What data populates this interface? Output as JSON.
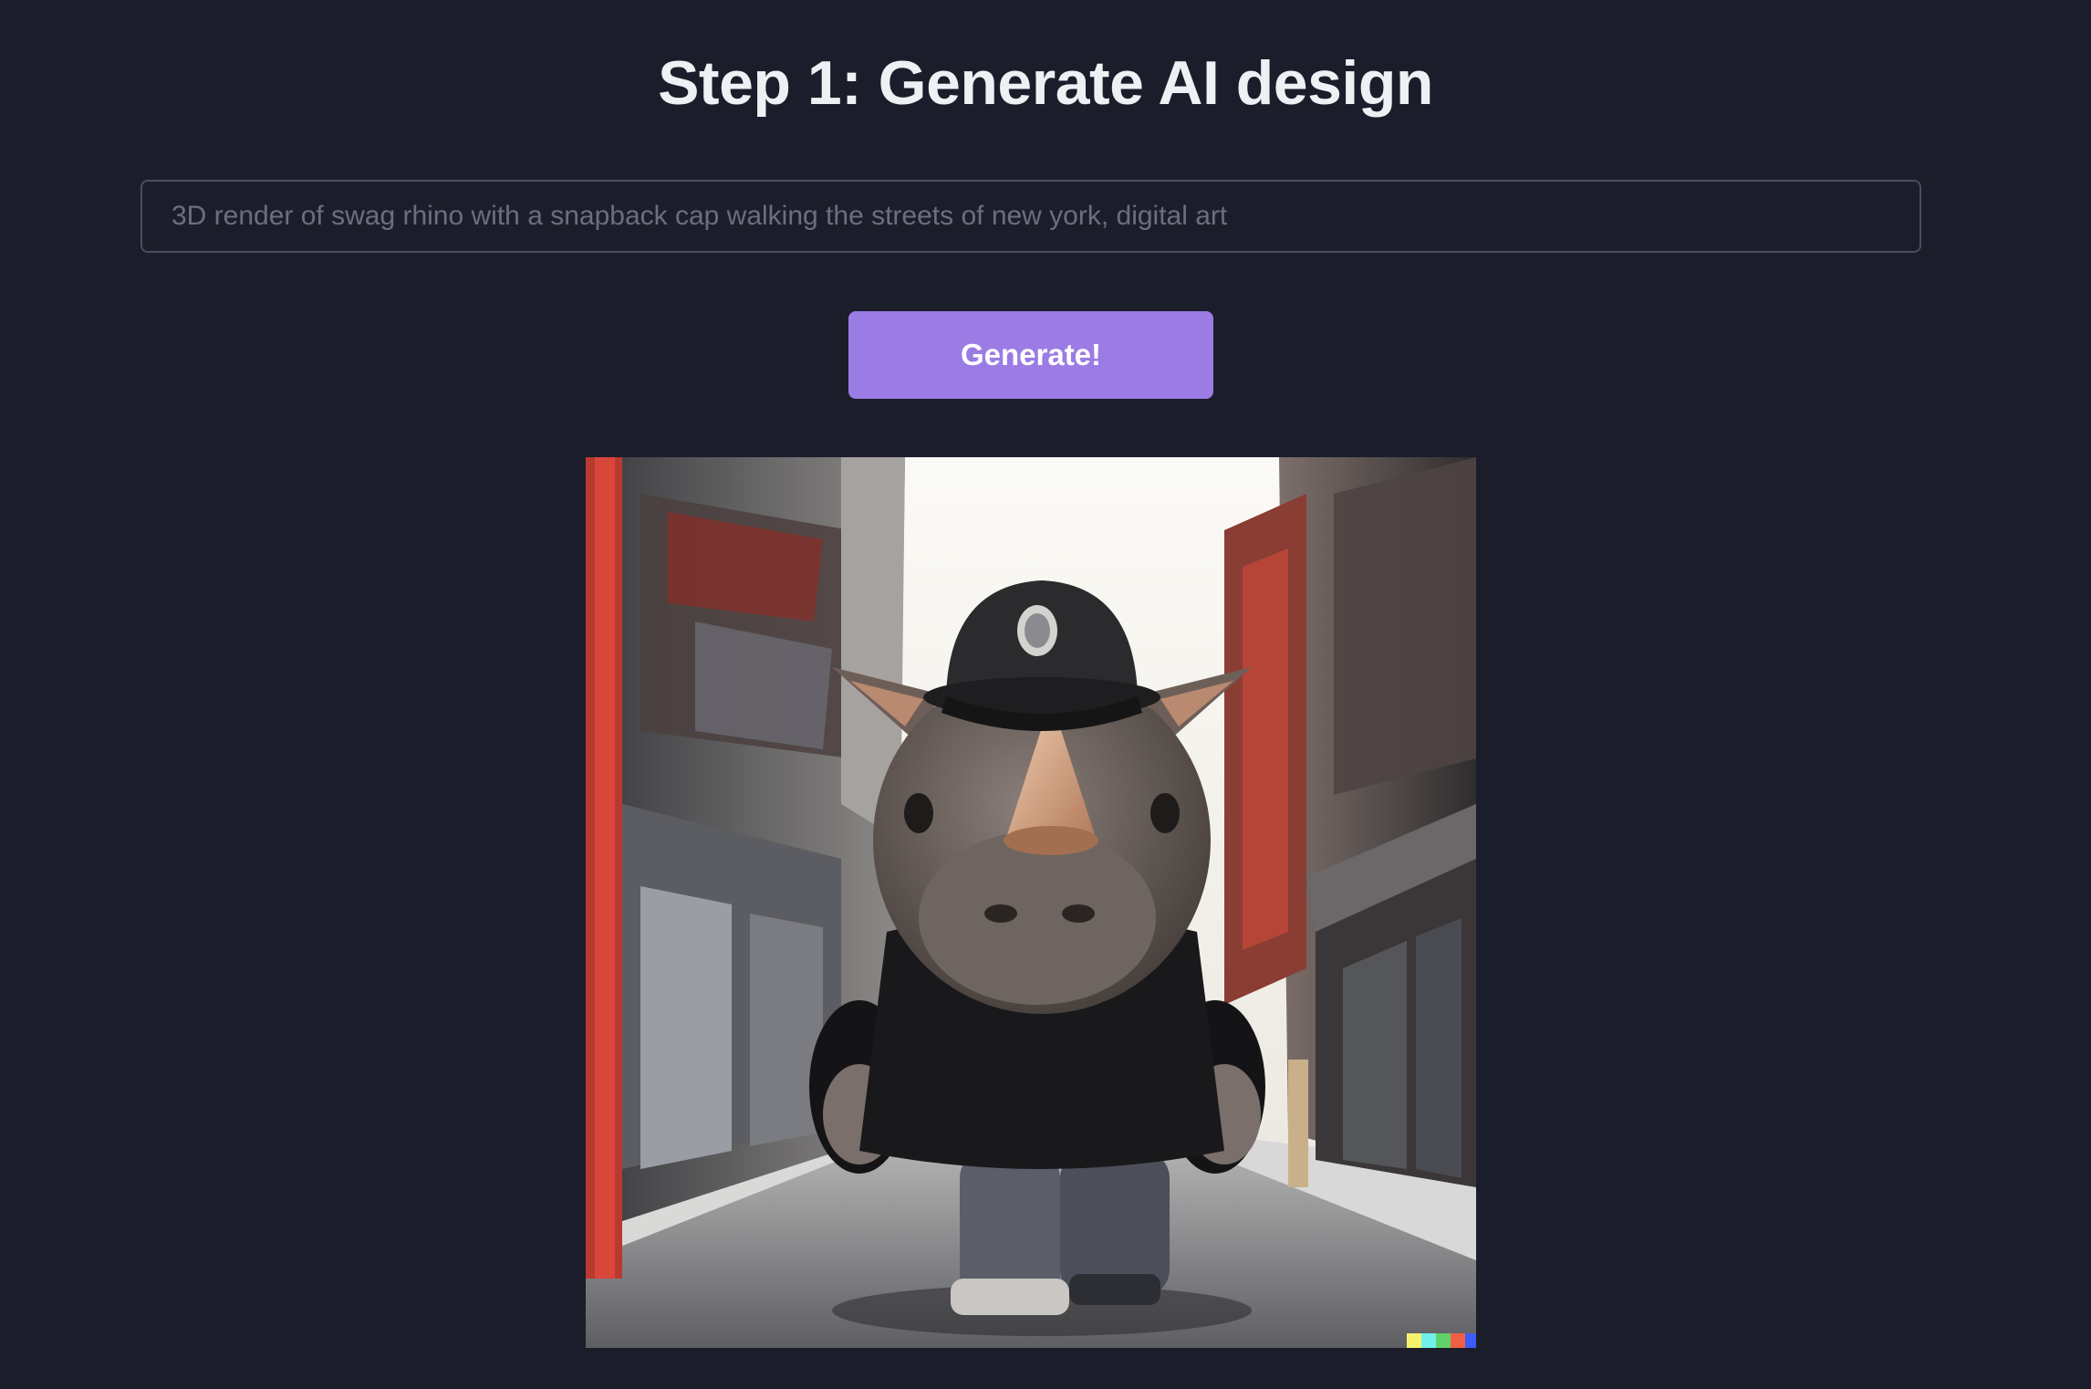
{
  "header": {
    "title": "Step 1: Generate AI design"
  },
  "prompt": {
    "placeholder": "3D render of swag rhino with a snapback cap walking the streets of new york, digital art",
    "value": ""
  },
  "actions": {
    "generate_label": "Generate!"
  },
  "result": {
    "image": "generated-rhino-image",
    "accent": "#9b7be4"
  }
}
